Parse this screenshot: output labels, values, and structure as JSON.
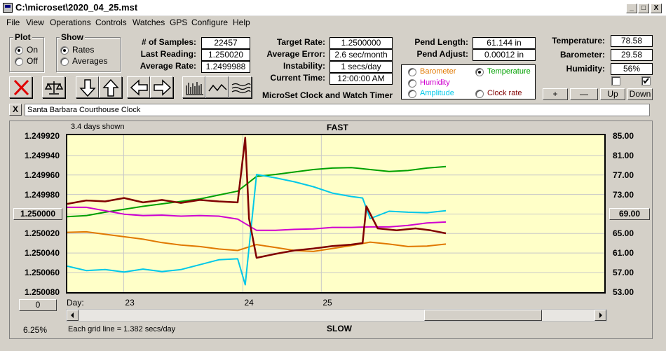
{
  "window": {
    "title": "C:\\microset\\2020_04_25.mst",
    "minimize": "_",
    "maximize": "□",
    "close": "X"
  },
  "menu": [
    "File",
    "View",
    "Operations",
    "Controls",
    "Watches",
    "GPS",
    "Configure",
    "Help"
  ],
  "plot_group": {
    "title": "Plot",
    "on": "On",
    "off": "Off",
    "selected": "On"
  },
  "show_group": {
    "title": "Show",
    "rates": "Rates",
    "averages": "Averages",
    "selected": "Rates"
  },
  "stats": {
    "samples_label": "# of Samples:",
    "samples": "22457",
    "last_reading_label": "Last Reading:",
    "last_reading": "1.250020",
    "average_rate_label": "Average Rate:",
    "average_rate": "1.2499988"
  },
  "rates": {
    "target_rate_label": "Target Rate:",
    "target_rate": "1.2500000",
    "average_error_label": "Average Error:",
    "average_error": "2.6 sec/month",
    "instability_label": "Instability:",
    "instability": "1 secs/day",
    "current_time_label": "Current Time:",
    "current_time": "12:00:00 AM"
  },
  "app_name": "MicroSet Clock and Watch Timer",
  "pendulum": {
    "length_label": "Pend Length:",
    "length": "61.144 in",
    "adjust_label": "Pend Adjust:",
    "adjust": "0.00012 in"
  },
  "sensors": {
    "barometer": "Barometer",
    "temperature": "Temperature",
    "humidity": "Humidity",
    "amplitude": "Amplitude",
    "clock_rate": "Clock rate",
    "selected": "Temperature",
    "colors": {
      "barometer": "#e07800",
      "temperature": "#00a000",
      "humidity": "#d000d0",
      "amplitude": "#00c8e8",
      "clock_rate": "#800000"
    }
  },
  "environment": {
    "temperature_label": "Temperature:",
    "temperature": "78.58",
    "barometer_label": "Barometer:",
    "barometer": "29.58",
    "humidity_label": "Humidity:",
    "humidity": "56%"
  },
  "adjust_buttons": {
    "plus": "+",
    "minus": "—",
    "up": "Up",
    "down": "Down"
  },
  "clock_name": "Santa Barbara Courthouse Clock",
  "clear_button": "X",
  "chart": {
    "days_shown": "3.4 days shown",
    "fast_label": "FAST",
    "slow_label": "SLOW",
    "left_center": "1.250000",
    "right_center": "69.00",
    "bottom_left_btn": "0",
    "percent": "6.25%",
    "grid_note": "Each grid line = 1.382 secs/day",
    "day_label": "Day:"
  },
  "chart_data": {
    "type": "line",
    "y_left_ticks": [
      "1.249920",
      "1.249940",
      "1.249960",
      "1.249980",
      "1.250000",
      "1.250020",
      "1.250040",
      "1.250060",
      "1.250080"
    ],
    "y_right_ticks": [
      "85.00",
      "81.00",
      "77.00",
      "73.00",
      "69.00",
      "65.00",
      "61.00",
      "57.00",
      "53.00"
    ],
    "x_ticks": [
      "23",
      "24",
      "25"
    ],
    "series": [
      {
        "name": "Temperature",
        "color": "#00a000",
        "x": [
          0,
          0.05,
          0.1,
          0.15,
          0.2,
          0.25,
          0.3,
          0.35,
          0.4,
          0.45,
          0.5,
          0.55,
          0.6,
          0.65,
          0.7,
          0.75,
          0.8,
          0.85,
          0.9,
          0.95,
          1.0
        ],
        "y": [
          68.4,
          68.6,
          69.3,
          69.9,
          70.5,
          71.0,
          71.5,
          72.0,
          72.8,
          73.6,
          76.6,
          77.0,
          77.5,
          78.0,
          78.3,
          78.4,
          78.0,
          77.6,
          77.8,
          78.3,
          78.6
        ]
      },
      {
        "name": "Humidity",
        "color": "#d000d0",
        "x": [
          0,
          0.05,
          0.1,
          0.15,
          0.2,
          0.25,
          0.3,
          0.35,
          0.4,
          0.45,
          0.5,
          0.55,
          0.6,
          0.65,
          0.7,
          0.75,
          0.8,
          0.85,
          0.9,
          0.95,
          1.0
        ],
        "y": [
          70.3,
          70.3,
          69.6,
          68.9,
          68.6,
          68.7,
          68.5,
          68.6,
          68.5,
          67.9,
          65.6,
          65.6,
          65.8,
          65.9,
          66.2,
          66.2,
          66.3,
          66.3,
          66.6,
          67.1,
          67.3
        ]
      },
      {
        "name": "Barometer",
        "color": "#e07800",
        "x": [
          0,
          0.05,
          0.1,
          0.15,
          0.2,
          0.25,
          0.3,
          0.35,
          0.4,
          0.45,
          0.5,
          0.55,
          0.6,
          0.65,
          0.7,
          0.75,
          0.8,
          0.85,
          0.9,
          0.95,
          1.0
        ],
        "y": [
          65.2,
          65.3,
          64.8,
          64.3,
          63.8,
          63.1,
          62.6,
          62.3,
          61.8,
          61.5,
          62.7,
          62.1,
          61.5,
          61.3,
          61.9,
          62.5,
          63.2,
          62.8,
          62.3,
          62.4,
          62.8
        ]
      },
      {
        "name": "Amplitude",
        "color": "#00c8e8",
        "x": [
          0,
          0.05,
          0.1,
          0.15,
          0.2,
          0.25,
          0.3,
          0.35,
          0.4,
          0.45,
          0.47,
          0.5,
          0.55,
          0.6,
          0.65,
          0.7,
          0.75,
          0.78,
          0.8,
          0.85,
          0.9,
          0.95,
          1.0
        ],
        "y": [
          58.3,
          57.4,
          57.6,
          57.1,
          57.7,
          57.2,
          57.6,
          58.6,
          59.6,
          59.8,
          54.5,
          77.0,
          76.3,
          75.5,
          74.5,
          73.2,
          72.5,
          72.2,
          68.0,
          69.5,
          69.3,
          69.2,
          69.6
        ]
      },
      {
        "name": "Clock rate",
        "color": "#800000",
        "x": [
          0,
          0.05,
          0.1,
          0.15,
          0.2,
          0.25,
          0.3,
          0.35,
          0.4,
          0.45,
          0.47,
          0.48,
          0.5,
          0.55,
          0.6,
          0.65,
          0.7,
          0.75,
          0.78,
          0.79,
          0.82,
          0.87,
          0.92,
          0.96,
          1.0
        ],
        "y": [
          71.0,
          71.7,
          71.5,
          72.2,
          71.3,
          71.8,
          71.2,
          71.8,
          71.5,
          71.3,
          84.5,
          68.0,
          60.0,
          60.8,
          61.5,
          61.9,
          62.4,
          62.7,
          63.0,
          70.5,
          66.0,
          65.6,
          66.0,
          65.6,
          65.0
        ]
      }
    ]
  }
}
